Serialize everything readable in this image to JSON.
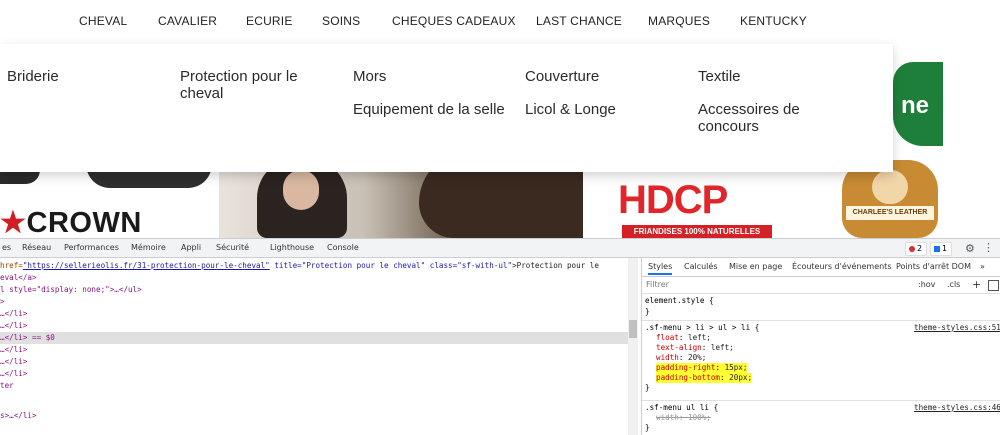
{
  "nav": [
    "CHEVAL",
    "CAVALIER",
    "ECURIE",
    "SOINS",
    "CHEQUES CADEAUX",
    "LAST CHANCE",
    "MARQUES",
    "KENTUCKY"
  ],
  "dropdown": {
    "briderie": "Briderie",
    "protection": "Protection pour le cheval",
    "mors": "Mors",
    "equipement": "Equipement de la selle",
    "couverture": "Couverture",
    "licol": "Licol & Longe",
    "textile": "Textile",
    "accessoires": "Accessoires de concours"
  },
  "banners": {
    "crown": "CROWN",
    "hdcp": "HDCP",
    "hdcp_sub": "FRIANDISES 100% NATURELLES",
    "charlee": "CHARLEE'S LEATHER"
  },
  "devtools": {
    "tabs": [
      "es",
      "Réseau",
      "Performances",
      "Mémoire",
      "Appli",
      "Sécurité",
      "Lighthouse",
      "Console"
    ],
    "errors": "2",
    "infos": "1",
    "elements": {
      "line1_attr_href": "href=",
      "line1_href": "\"https://sellerieolis.fr/31-protection-pour-le-cheval\"",
      "line1_title": " title=\"Protection pour le cheval\"",
      "line1_class": " class=\"sf-with-ul\"",
      "line1_text": ">Protection pour le",
      "line2": "eval</a>",
      "line3": "l style=\"display: none;\">…</ul>",
      "line4": ">",
      "line5": "…</li>",
      "line6": "…</li>",
      "line7": "…</li> == $0",
      "line8": "…</li>",
      "line9": "…</li>",
      "line10": "…</li>",
      "line11": "ter",
      "line12": "s>…</li>"
    },
    "styles_tabs": [
      "Styles",
      "Calculés",
      "Mise en page",
      "Écouteurs d'événements",
      "Points d'arrêt DOM",
      "»"
    ],
    "filter_placeholder": "Filtrer",
    "hov": ":hov",
    "cls": ".cls",
    "plus": "+",
    "rule0_selector": "element.style {",
    "rule0_close": "}",
    "rule1_selector": ".sf-menu > li > ul > li {",
    "rule1_source": "theme-styles.css:51",
    "rule1_props": [
      {
        "p": "float",
        "v": "left;"
      },
      {
        "p": "text-align",
        "v": "left;"
      },
      {
        "p": "width",
        "v": "20%;"
      },
      {
        "p": "padding-right",
        "v": "15px;"
      },
      {
        "p": "padding-bottom",
        "v": "20px;"
      }
    ],
    "rule1_close": "}",
    "rule2_selector": ".sf-menu ul li {",
    "rule2_source": "theme-styles.css:46",
    "rule2_prop": "width",
    "rule2_val": "100%;",
    "rule2_close": "}"
  }
}
